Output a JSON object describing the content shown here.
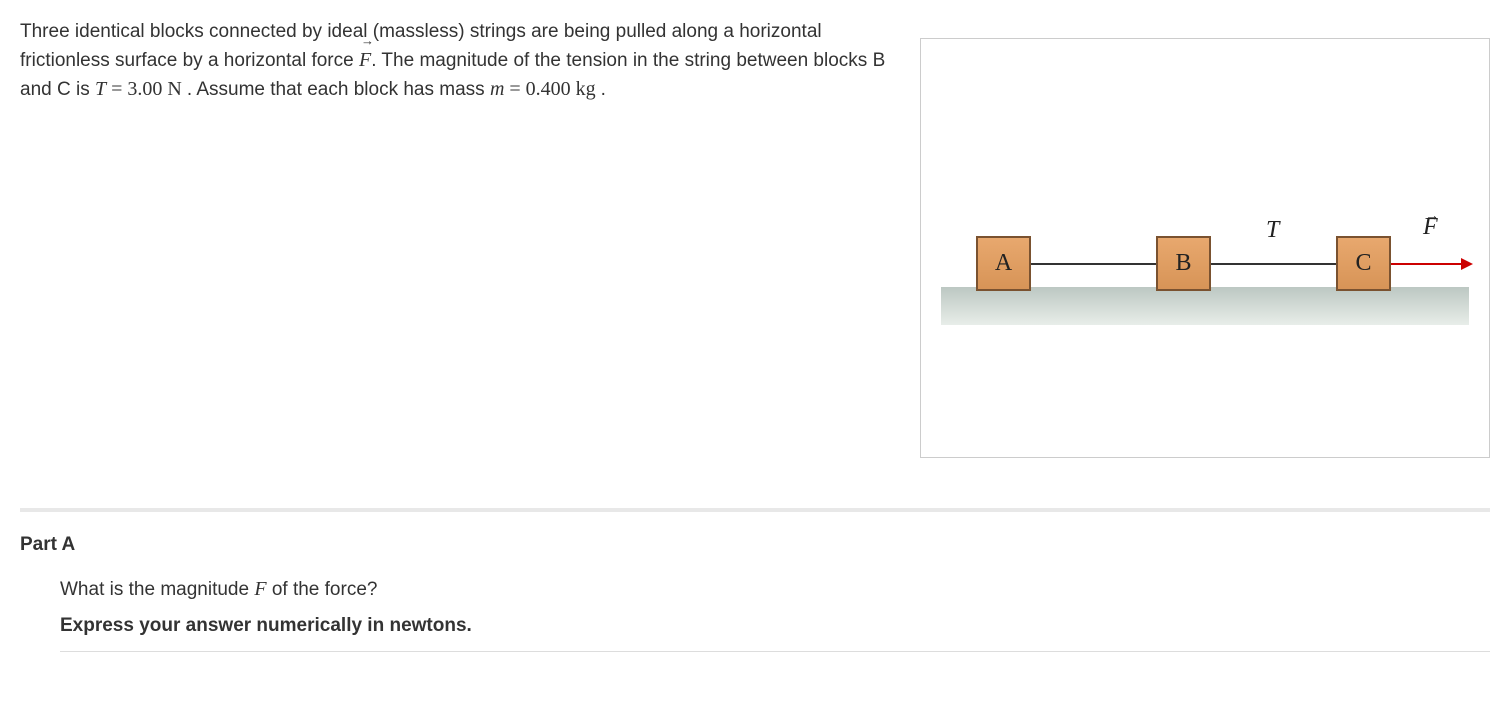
{
  "problem": {
    "line1_a": "Three identical blocks connected by ideal (massless) strings are being pulled along a horizontal frictionless surface by a horizontal force ",
    "force_var": "F",
    "line1_b": ". The magnitude of the tension in the string between blocks B and C is ",
    "tension_var": "T",
    "equals1": " = ",
    "tension_val": "3.00",
    "tension_unit": " N ",
    "line1_c": ". Assume that each block has mass ",
    "mass_var": "m",
    "equals2": " = ",
    "mass_val": "0.400",
    "mass_unit": " kg ",
    "period": "."
  },
  "figure": {
    "block_a": "A",
    "block_b": "B",
    "block_c": "C",
    "label_t": "T",
    "label_f": "F"
  },
  "part_a": {
    "heading": "Part A",
    "question_a": "What is the magnitude ",
    "question_var": "F",
    "question_b": " of the force?",
    "instruction": "Express your answer numerically in newtons."
  }
}
